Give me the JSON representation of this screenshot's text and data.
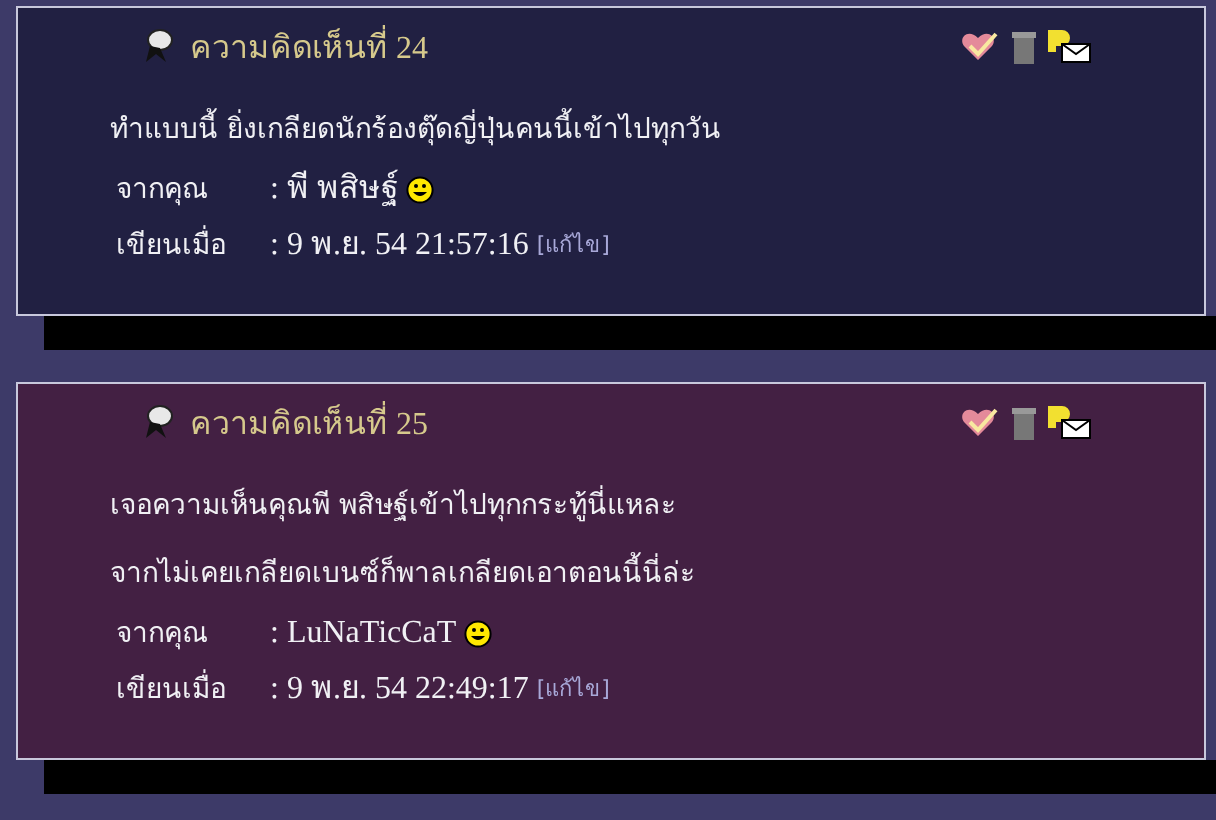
{
  "comments": [
    {
      "title": "ความคิดเห็นที่ 24",
      "color": "#212042",
      "paragraphs": [
        "ทำแบบนี้ ยิ่งเกลียดนักร้องตุ๊ดญี่ปุ่นคนนี้เข้าไปทุกวัน"
      ],
      "from_label": "จากคุณ",
      "author": ": พี พสิษฐ์",
      "date_label": "เขียนเมื่อ",
      "date": ": 9 พ.ย. 54 21:57:16",
      "edit": "[แก้ไข]"
    },
    {
      "title": "ความคิดเห็นที่ 25",
      "color": "#432043",
      "paragraphs": [
        "เจอความเห็นคุณพี พสิษฐ์เข้าไปทุกกระทู้นี่แหละ",
        "จากไม่เคยเกลียดเบนซ์ก็พาลเกลียดเอาตอนนี้นี่ล่ะ"
      ],
      "from_label": "จากคุณ",
      "author": ": LuNaTicCaT",
      "date_label": "เขียนเมื่อ",
      "date": ": 9 พ.ย. 54 22:49:17",
      "edit": "[แก้ไข]"
    }
  ]
}
